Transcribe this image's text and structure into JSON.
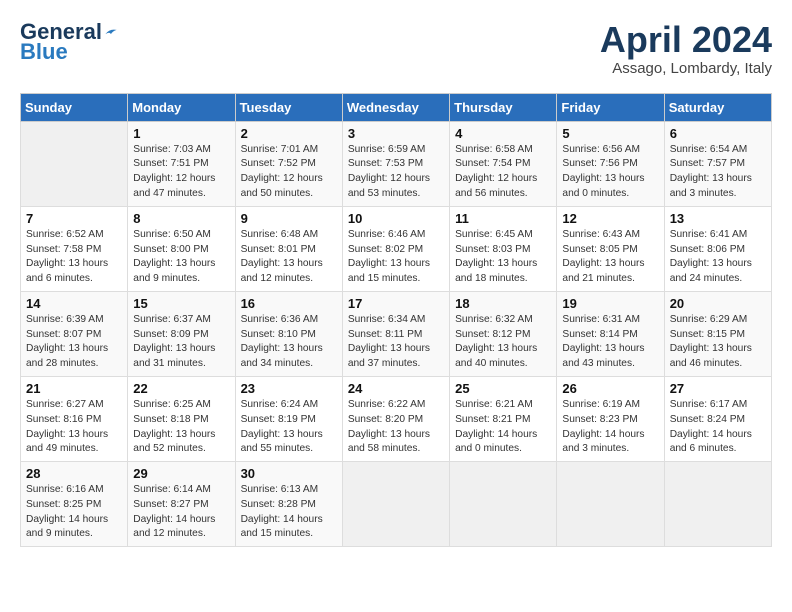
{
  "header": {
    "logo_line1": "General",
    "logo_line2": "Blue",
    "month": "April 2024",
    "location": "Assago, Lombardy, Italy"
  },
  "weekdays": [
    "Sunday",
    "Monday",
    "Tuesday",
    "Wednesday",
    "Thursday",
    "Friday",
    "Saturday"
  ],
  "weeks": [
    [
      {
        "day": "",
        "info": ""
      },
      {
        "day": "1",
        "info": "Sunrise: 7:03 AM\nSunset: 7:51 PM\nDaylight: 12 hours\nand 47 minutes."
      },
      {
        "day": "2",
        "info": "Sunrise: 7:01 AM\nSunset: 7:52 PM\nDaylight: 12 hours\nand 50 minutes."
      },
      {
        "day": "3",
        "info": "Sunrise: 6:59 AM\nSunset: 7:53 PM\nDaylight: 12 hours\nand 53 minutes."
      },
      {
        "day": "4",
        "info": "Sunrise: 6:58 AM\nSunset: 7:54 PM\nDaylight: 12 hours\nand 56 minutes."
      },
      {
        "day": "5",
        "info": "Sunrise: 6:56 AM\nSunset: 7:56 PM\nDaylight: 13 hours\nand 0 minutes."
      },
      {
        "day": "6",
        "info": "Sunrise: 6:54 AM\nSunset: 7:57 PM\nDaylight: 13 hours\nand 3 minutes."
      }
    ],
    [
      {
        "day": "7",
        "info": "Sunrise: 6:52 AM\nSunset: 7:58 PM\nDaylight: 13 hours\nand 6 minutes."
      },
      {
        "day": "8",
        "info": "Sunrise: 6:50 AM\nSunset: 8:00 PM\nDaylight: 13 hours\nand 9 minutes."
      },
      {
        "day": "9",
        "info": "Sunrise: 6:48 AM\nSunset: 8:01 PM\nDaylight: 13 hours\nand 12 minutes."
      },
      {
        "day": "10",
        "info": "Sunrise: 6:46 AM\nSunset: 8:02 PM\nDaylight: 13 hours\nand 15 minutes."
      },
      {
        "day": "11",
        "info": "Sunrise: 6:45 AM\nSunset: 8:03 PM\nDaylight: 13 hours\nand 18 minutes."
      },
      {
        "day": "12",
        "info": "Sunrise: 6:43 AM\nSunset: 8:05 PM\nDaylight: 13 hours\nand 21 minutes."
      },
      {
        "day": "13",
        "info": "Sunrise: 6:41 AM\nSunset: 8:06 PM\nDaylight: 13 hours\nand 24 minutes."
      }
    ],
    [
      {
        "day": "14",
        "info": "Sunrise: 6:39 AM\nSunset: 8:07 PM\nDaylight: 13 hours\nand 28 minutes."
      },
      {
        "day": "15",
        "info": "Sunrise: 6:37 AM\nSunset: 8:09 PM\nDaylight: 13 hours\nand 31 minutes."
      },
      {
        "day": "16",
        "info": "Sunrise: 6:36 AM\nSunset: 8:10 PM\nDaylight: 13 hours\nand 34 minutes."
      },
      {
        "day": "17",
        "info": "Sunrise: 6:34 AM\nSunset: 8:11 PM\nDaylight: 13 hours\nand 37 minutes."
      },
      {
        "day": "18",
        "info": "Sunrise: 6:32 AM\nSunset: 8:12 PM\nDaylight: 13 hours\nand 40 minutes."
      },
      {
        "day": "19",
        "info": "Sunrise: 6:31 AM\nSunset: 8:14 PM\nDaylight: 13 hours\nand 43 minutes."
      },
      {
        "day": "20",
        "info": "Sunrise: 6:29 AM\nSunset: 8:15 PM\nDaylight: 13 hours\nand 46 minutes."
      }
    ],
    [
      {
        "day": "21",
        "info": "Sunrise: 6:27 AM\nSunset: 8:16 PM\nDaylight: 13 hours\nand 49 minutes."
      },
      {
        "day": "22",
        "info": "Sunrise: 6:25 AM\nSunset: 8:18 PM\nDaylight: 13 hours\nand 52 minutes."
      },
      {
        "day": "23",
        "info": "Sunrise: 6:24 AM\nSunset: 8:19 PM\nDaylight: 13 hours\nand 55 minutes."
      },
      {
        "day": "24",
        "info": "Sunrise: 6:22 AM\nSunset: 8:20 PM\nDaylight: 13 hours\nand 58 minutes."
      },
      {
        "day": "25",
        "info": "Sunrise: 6:21 AM\nSunset: 8:21 PM\nDaylight: 14 hours\nand 0 minutes."
      },
      {
        "day": "26",
        "info": "Sunrise: 6:19 AM\nSunset: 8:23 PM\nDaylight: 14 hours\nand 3 minutes."
      },
      {
        "day": "27",
        "info": "Sunrise: 6:17 AM\nSunset: 8:24 PM\nDaylight: 14 hours\nand 6 minutes."
      }
    ],
    [
      {
        "day": "28",
        "info": "Sunrise: 6:16 AM\nSunset: 8:25 PM\nDaylight: 14 hours\nand 9 minutes."
      },
      {
        "day": "29",
        "info": "Sunrise: 6:14 AM\nSunset: 8:27 PM\nDaylight: 14 hours\nand 12 minutes."
      },
      {
        "day": "30",
        "info": "Sunrise: 6:13 AM\nSunset: 8:28 PM\nDaylight: 14 hours\nand 15 minutes."
      },
      {
        "day": "",
        "info": ""
      },
      {
        "day": "",
        "info": ""
      },
      {
        "day": "",
        "info": ""
      },
      {
        "day": "",
        "info": ""
      }
    ]
  ]
}
